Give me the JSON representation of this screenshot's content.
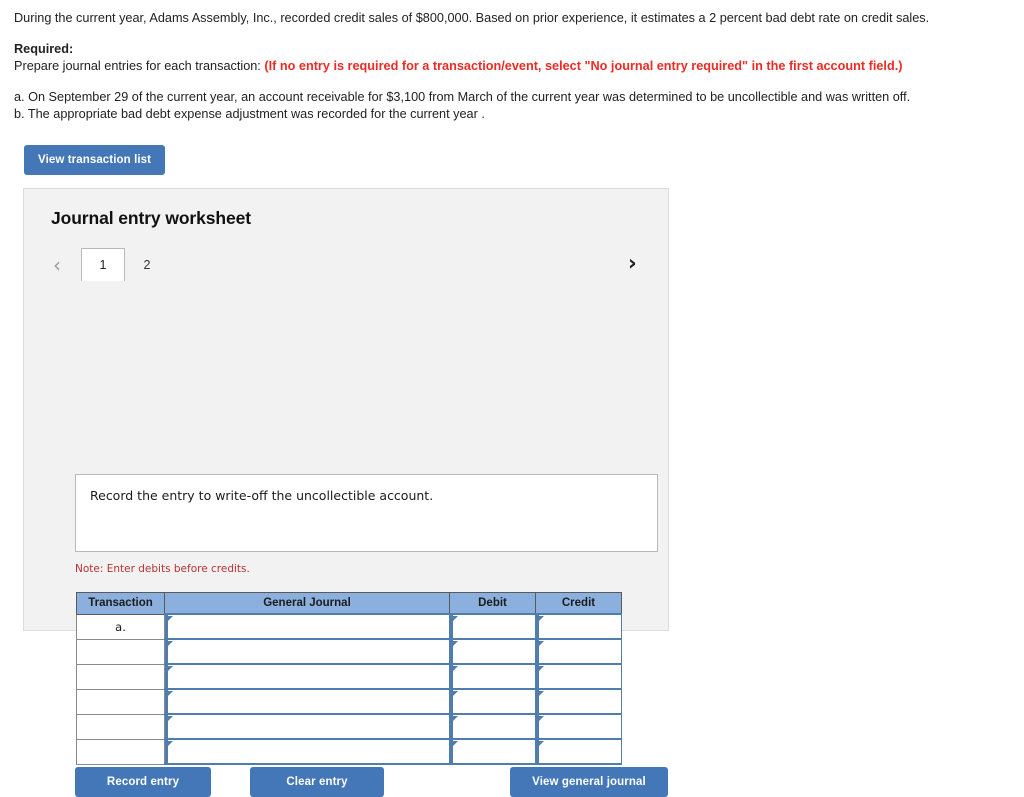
{
  "problem": {
    "intro": "During the current year, Adams Assembly, Inc., recorded credit sales of $800,000. Based on prior experience, it estimates a 2 percent bad debt rate on credit sales.",
    "required_label": "Required:",
    "required_text": "Prepare journal entries for each transaction:",
    "required_note": "(If no entry is required for a transaction/event, select \"No journal entry required\" in the first account field.)",
    "item_a": "a. On September 29 of the current year, an account receivable for  $3,100 from March of the current year was determined to be uncollectible and was written off.",
    "item_b": "b. The appropriate bad debt expense adjustment was recorded for the current year ."
  },
  "toolbar": {
    "view_transaction_list_label": "View transaction list"
  },
  "worksheet": {
    "title": "Journal entry worksheet",
    "prev_arrow": "‹",
    "next_arrow": "›",
    "tabs": [
      {
        "label": "1",
        "active": true
      },
      {
        "label": "2",
        "active": false
      }
    ],
    "description": "Record the entry to write-off the uncollectible account.",
    "note": "Note: Enter debits before credits.",
    "table": {
      "headers": [
        "Transaction",
        "General Journal",
        "Debit",
        "Credit"
      ],
      "rows": [
        {
          "transaction": "a.",
          "general_journal": "",
          "debit": "",
          "credit": ""
        },
        {
          "transaction": "",
          "general_journal": "",
          "debit": "",
          "credit": ""
        },
        {
          "transaction": "",
          "general_journal": "",
          "debit": "",
          "credit": ""
        },
        {
          "transaction": "",
          "general_journal": "",
          "debit": "",
          "credit": ""
        },
        {
          "transaction": "",
          "general_journal": "",
          "debit": "",
          "credit": ""
        },
        {
          "transaction": "",
          "general_journal": "",
          "debit": "",
          "credit": ""
        }
      ]
    },
    "buttons": {
      "record_entry": "Record entry",
      "clear_entry": "Clear entry",
      "view_general_journal": "View general journal"
    }
  },
  "colors": {
    "button_blue": "#4377b8",
    "header_blue": "#8cb0de",
    "note_red": "#b83232",
    "instruction_red": "#ee2b24",
    "panel_gray": "#f2f2f2"
  }
}
